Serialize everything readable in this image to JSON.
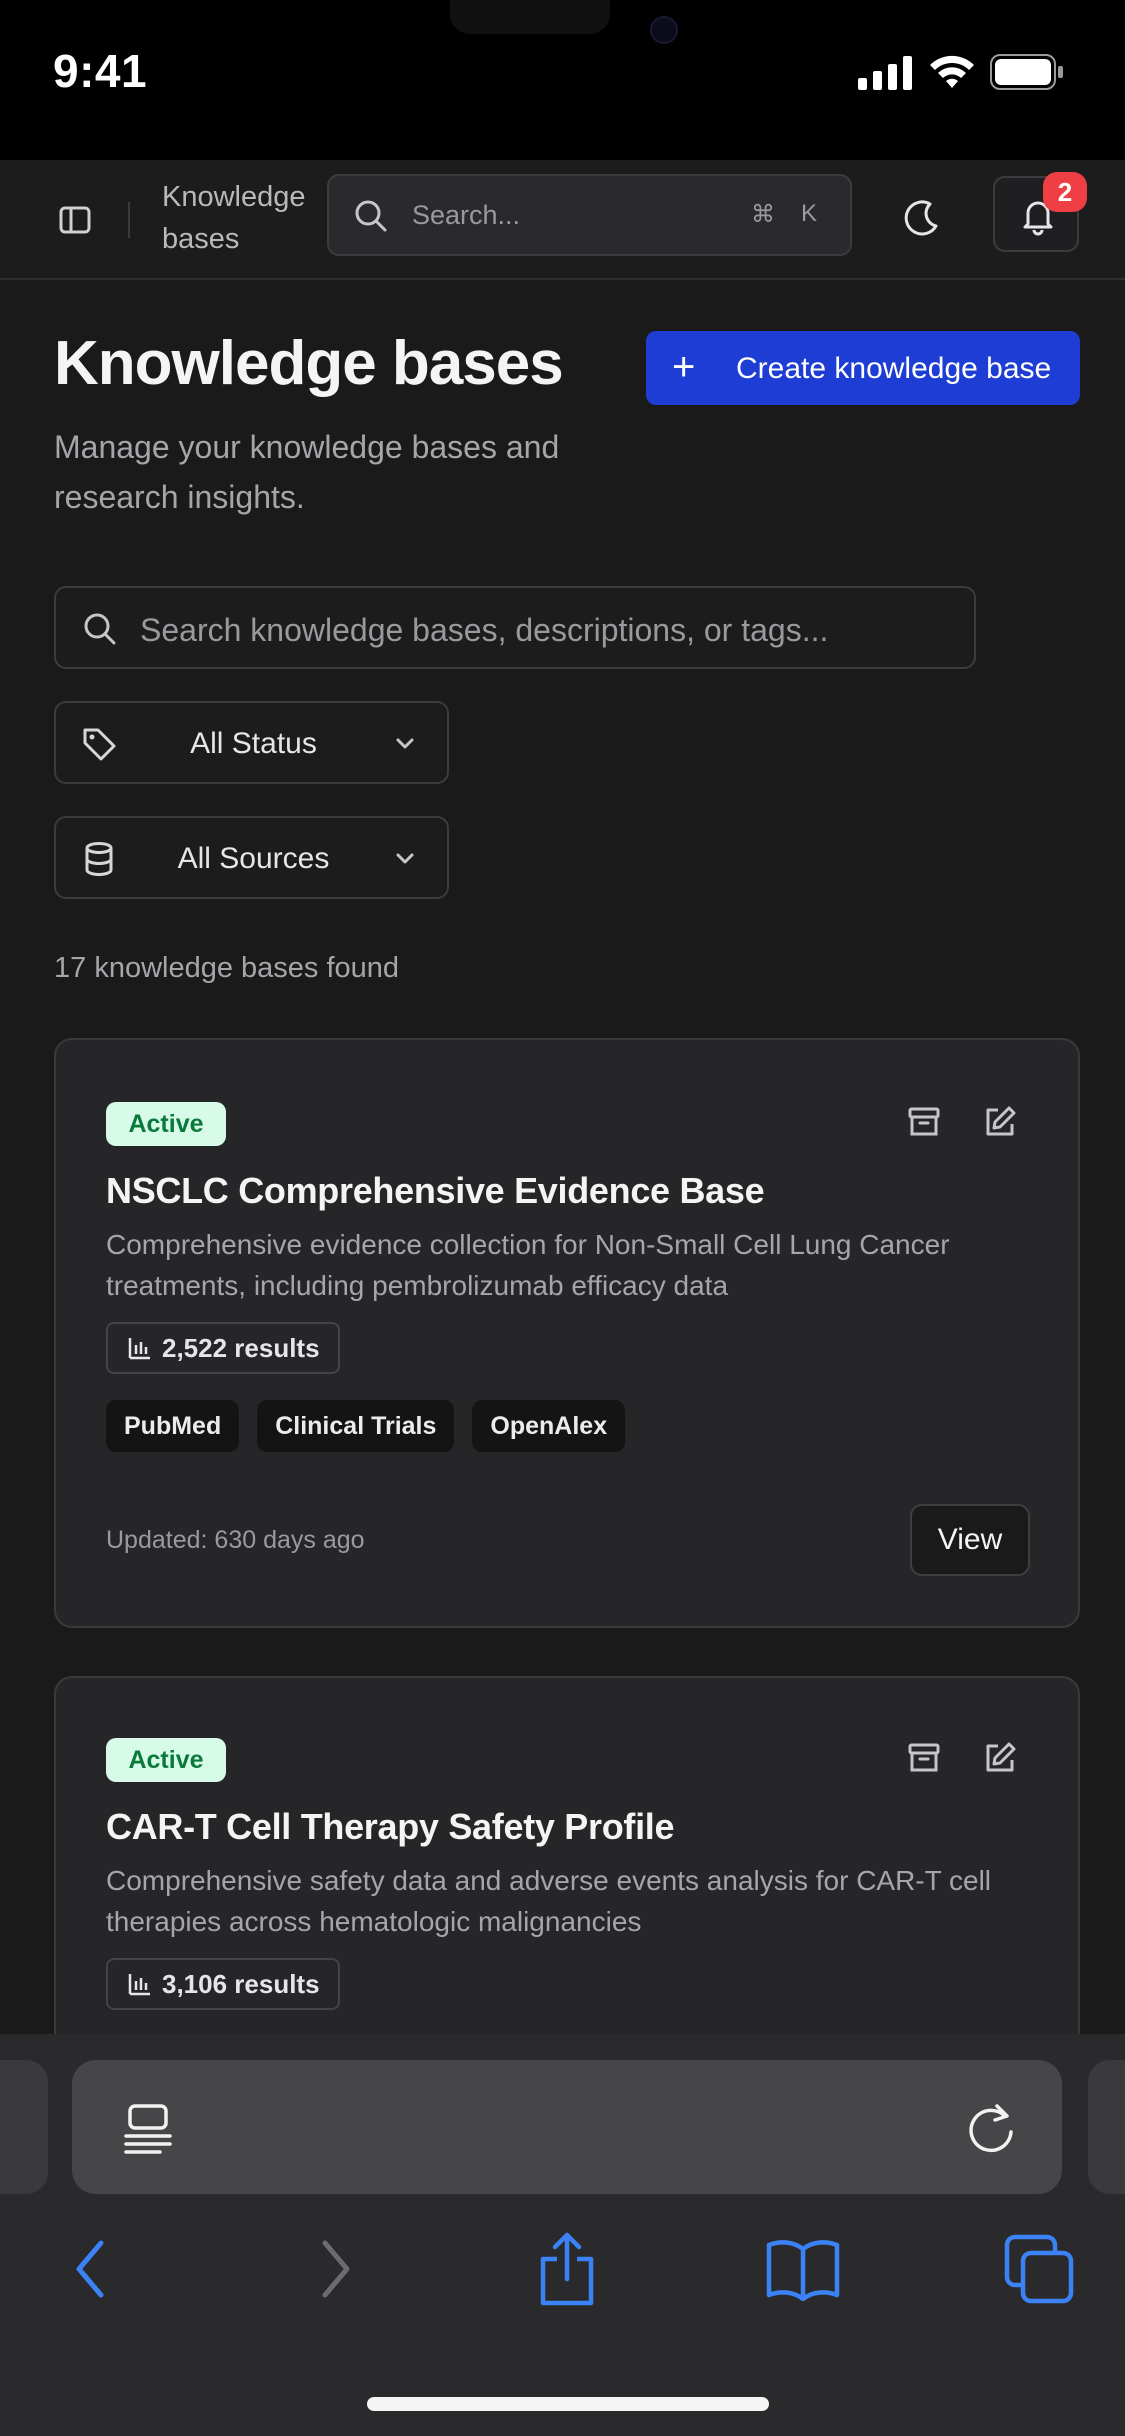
{
  "status_bar": {
    "time": "9:41"
  },
  "header": {
    "breadcrumb": "Knowledge bases",
    "search_placeholder": "Search...",
    "shortcut_symbol": "⌘",
    "shortcut_key": "K",
    "notification_count": "2"
  },
  "page": {
    "title": "Knowledge bases",
    "subtitle": "Manage your knowledge bases and research insights.",
    "create_button_label": "Create knowledge base",
    "search_placeholder": "Search knowledge bases, descriptions, or tags...",
    "status_filter": "All Status",
    "source_filter": "All Sources",
    "result_count": "17 knowledge bases found"
  },
  "cards": [
    {
      "status": "Active",
      "title": "NSCLC Comprehensive Evidence Base",
      "description": "Comprehensive evidence collection for Non-Small Cell Lung Cancer treatments, including pembrolizumab efficacy data",
      "results": "2,522 results",
      "tags": [
        "PubMed",
        "Clinical Trials",
        "OpenAlex"
      ],
      "updated": "Updated: 630 days ago",
      "view_label": "View"
    },
    {
      "status": "Active",
      "title": "CAR-T Cell Therapy Safety Profile",
      "description": "Comprehensive safety data and adverse events analysis for CAR-T cell therapies across hematologic malignancies",
      "results": "3,106 results"
    }
  ],
  "colors": {
    "background": "#1a1a1b",
    "accent": "#1e3dd4",
    "status_active_bg": "#d7fbe8",
    "status_active_text": "#0a7a3a",
    "badge": "#ef3e44",
    "safari_link": "#3b82f6"
  },
  "icons": {
    "header": [
      "sidebar-toggle-icon",
      "search-icon",
      "moon-icon",
      "bell-icon"
    ],
    "card_actions": [
      "archive-icon",
      "edit-icon"
    ],
    "filters": [
      "tag-icon",
      "database-icon",
      "chevron-down-icon"
    ],
    "safari": [
      "reader-icon",
      "reload-icon",
      "back-icon",
      "forward-icon",
      "share-icon",
      "bookmarks-icon",
      "tabs-icon"
    ]
  }
}
